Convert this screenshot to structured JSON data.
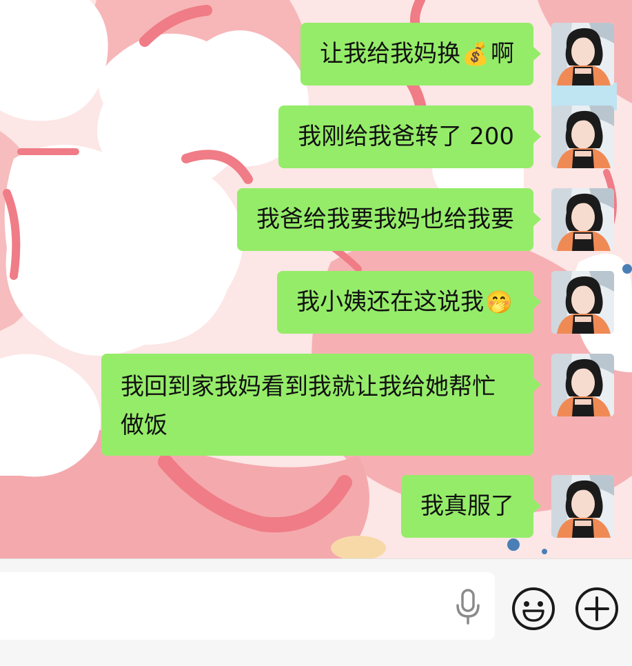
{
  "conversation": {
    "messages": [
      {
        "text": "让我给我妈换",
        "emoji": "💰",
        "suffix": "啊"
      },
      {
        "text": "我刚给我爸转了 200",
        "emoji": "",
        "suffix": ""
      },
      {
        "text": "我爸给我要我妈也给我要",
        "emoji": "",
        "suffix": ""
      },
      {
        "text": "我小姨还在这说我",
        "emoji": "🤭",
        "suffix": ""
      },
      {
        "text": "我回到家我妈看到我就让我给她帮忙做饭",
        "emoji": "",
        "suffix": ""
      },
      {
        "text": "我真服了",
        "emoji": "",
        "suffix": ""
      }
    ]
  },
  "input_bar": {
    "message_value": "",
    "icons": {
      "voice": "microphone-icon",
      "emoji": "smiley-face-icon",
      "more": "plus-circle-icon"
    }
  },
  "colors": {
    "bubble": "#95ec69",
    "wallpaper_pink": "#f7b9b9",
    "wallpaper_red": "#ee7f86",
    "input_bar_bg": "#f6f6f6"
  }
}
